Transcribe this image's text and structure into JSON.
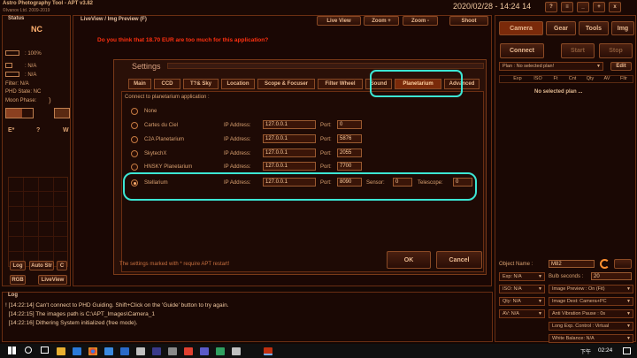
{
  "app": {
    "title": "Astro Photography Tool - APT v3.82",
    "copyright": "©Ivanov Ltd. 2009-2019",
    "datetime": "2020/02/28 - 14:24 14",
    "window_controls": [
      "?",
      "≡",
      "_",
      "+",
      "x"
    ]
  },
  "status": {
    "header": "Status",
    "camera": "NC",
    "cooler": ": 100%",
    "line2": ": N/A",
    "line3": ": N/A",
    "filter": "Filter: N/A",
    "phd": "PHD State: NC",
    "moon": "Moon Phase:",
    "moon_val": ")",
    "e_label": "E*",
    "q_label": "?",
    "w_label": "W",
    "log_btn": "Log",
    "autostr_btn": "Auto Str",
    "c_btn": "C",
    "rgb_btn": "RGB",
    "liveview_btn": "LiveView"
  },
  "liveview": {
    "header": "LiveView / Img Preview (F)",
    "top_buttons": [
      "Live View",
      "Zoom +",
      "Zoom -",
      "Shoot"
    ],
    "nag": "Do you think that 18.70 EUR are too much for this application?"
  },
  "settings": {
    "title": "Settings",
    "tabs": [
      "Main",
      "CCD",
      "T?& Sky",
      "Location",
      "Scope & Focuser",
      "Filter Wheel",
      "Sound",
      "Planetarium",
      "Advanced"
    ],
    "active_tab": "Planetarium",
    "group_label": "Connect to planetarium application :",
    "options": [
      {
        "name": "None"
      },
      {
        "name": "Cartes du Ciel",
        "ip": "127.0.0.1",
        "port": "0"
      },
      {
        "name": "C2A Planetarium",
        "ip": "127.0.0.1",
        "port": "5876"
      },
      {
        "name": "SkytechX",
        "ip": "127.0.0.1",
        "port": "2055"
      },
      {
        "name": "HNSKY Planetarium",
        "ip": "127.0.0.1",
        "port": "7700"
      },
      {
        "name": "Stellarium",
        "ip": "127.0.0.1",
        "port": "8090",
        "sensor": "0",
        "telescope": "0"
      }
    ],
    "ip_label": "IP Address:",
    "port_label": "Port:",
    "sensor_label": "Sensor:",
    "telescope_label": "Telescope:",
    "footer": "The settings marked with * require APT restart!",
    "ok": "OK",
    "cancel": "Cancel"
  },
  "right": {
    "tabs": [
      "Camera",
      "Gear",
      "Tools",
      "Img"
    ],
    "connect": "Connect",
    "start": "Start",
    "stop": "Stop",
    "plan": "Plan : No selected plan!",
    "edit": "Edit",
    "cols": [
      "Exp",
      "ISO",
      "Ft",
      "Cnt",
      "Qty",
      "AV",
      "Fltr"
    ],
    "no_plan": "No selected plan ...",
    "object_label": "Object Name :",
    "object_val": "M82",
    "bulb_label": "Bulb seconds :",
    "bulb_val": "20",
    "left_dd": [
      "Exp: N/A",
      "ISO: N/A",
      "Qty: N/A",
      "AV: N/A"
    ],
    "right_dd": [
      "Image Preview : On (Fit)",
      "Image Dest: Camera+PC",
      "Anti Vibration Pause : 0s",
      "Long Exp. Control : Virtual",
      "White Balance: N/A"
    ]
  },
  "log": {
    "header": "Log",
    "lines": [
      "! [14:22:14] Can't connect to PHD Guiding. Shift+Click on the 'Guide' button to try again.",
      "  [14:22:15] The images path is C:\\APT_Images\\Camera_1",
      "  [14:22:16] Dithering System initialized (free mode)."
    ]
  },
  "taskbar": {
    "time": "02:24",
    "ampm": "下午"
  },
  "colors": {
    "accent": "#ff8c00",
    "highlight": "#3ce6d4",
    "bg": "#140704"
  }
}
